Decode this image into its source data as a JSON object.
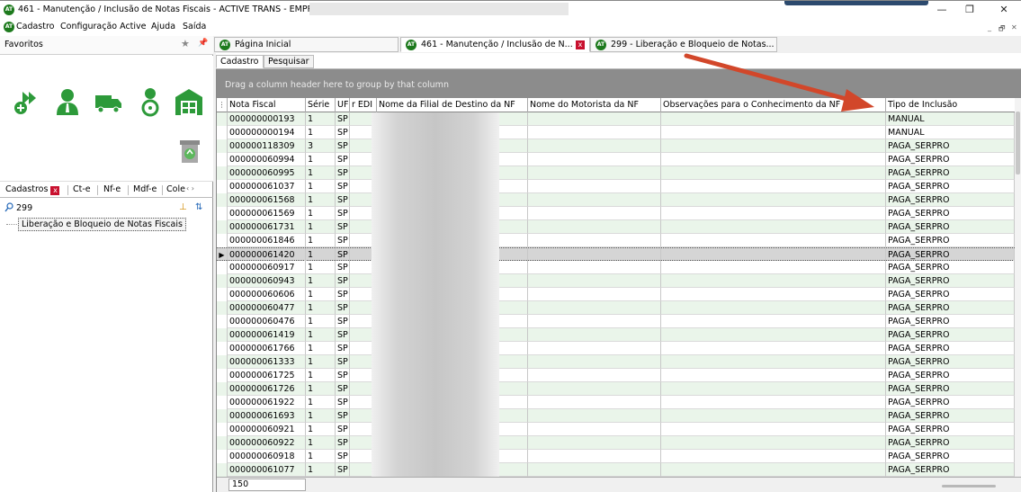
{
  "window": {
    "logo_text": "AT",
    "title": "461 - Manutenção / Inclusão de Notas Fiscais - ACTIVE TRANS - EMPRESA:",
    "minimize": "—",
    "restore": "❐",
    "close": "✕"
  },
  "menu": {
    "items": [
      "Cadastro",
      "Configuração Active",
      "Ajuda",
      "Saída"
    ],
    "mdi_controls": [
      "_",
      "🗗",
      "✕"
    ]
  },
  "favorites": {
    "title": "Favoritos",
    "star": "★",
    "pin": "📌"
  },
  "left_tabs": {
    "items": [
      "Cadastros",
      "Ct-e",
      "Nf-e",
      "Mdf-e",
      "Cole"
    ],
    "close": "x",
    "scroll": "‹  ›"
  },
  "search": {
    "value": "299",
    "tool_a": "⊥",
    "tool_b": "⇅"
  },
  "tree": {
    "item": "Liberação e Bloqueio de Notas Fiscais"
  },
  "doc_tabs": [
    {
      "label": "Página Inicial",
      "closable": false
    },
    {
      "label": "461 - Manutenção / Inclusão de N...",
      "closable": true
    },
    {
      "label": "299 - Liberação e Bloqueio de Notas...",
      "closable": false
    }
  ],
  "sub_tabs": [
    "Cadastro",
    "Pesquisar"
  ],
  "grid": {
    "group_hint": "Drag a column header here to group by that column",
    "indicator": "⋮",
    "headers": [
      "Nota Fiscal",
      "Série",
      "UF",
      "r EDI",
      "Nome da Filial de Destino da NF",
      "Nome do Motorista da NF",
      "Observações para o Conhecimento da NF",
      "Tipo de Inclusão"
    ],
    "rows": [
      {
        "nf": "000000000193",
        "serie": "1",
        "uf": "SP",
        "tipo": "MANUAL"
      },
      {
        "nf": "000000000194",
        "serie": "1",
        "uf": "SP",
        "tipo": "MANUAL"
      },
      {
        "nf": "000000118309",
        "serie": "3",
        "uf": "SP",
        "tipo": "PAGA_SERPRO"
      },
      {
        "nf": "000000060994",
        "serie": "1",
        "uf": "SP",
        "tipo": "PAGA_SERPRO"
      },
      {
        "nf": "000000060995",
        "serie": "1",
        "uf": "SP",
        "tipo": "PAGA_SERPRO"
      },
      {
        "nf": "000000061037",
        "serie": "1",
        "uf": "SP",
        "tipo": "PAGA_SERPRO"
      },
      {
        "nf": "000000061568",
        "serie": "1",
        "uf": "SP",
        "tipo": "PAGA_SERPRO"
      },
      {
        "nf": "000000061569",
        "serie": "1",
        "uf": "SP",
        "tipo": "PAGA_SERPRO"
      },
      {
        "nf": "000000061731",
        "serie": "1",
        "uf": "SP",
        "tipo": "PAGA_SERPRO"
      },
      {
        "nf": "000000061846",
        "serie": "1",
        "uf": "SP",
        "tipo": "PAGA_SERPRO"
      },
      {
        "nf": "000000061420",
        "serie": "1",
        "uf": "SP",
        "tipo": "PAGA_SERPRO",
        "selected": true
      },
      {
        "nf": "000000060917",
        "serie": "1",
        "uf": "SP",
        "tipo": "PAGA_SERPRO"
      },
      {
        "nf": "000000060943",
        "serie": "1",
        "uf": "SP",
        "tipo": "PAGA_SERPRO"
      },
      {
        "nf": "000000060606",
        "serie": "1",
        "uf": "SP",
        "tipo": "PAGA_SERPRO"
      },
      {
        "nf": "000000060477",
        "serie": "1",
        "uf": "SP",
        "tipo": "PAGA_SERPRO"
      },
      {
        "nf": "000000060476",
        "serie": "1",
        "uf": "SP",
        "tipo": "PAGA_SERPRO"
      },
      {
        "nf": "000000061419",
        "serie": "1",
        "uf": "SP",
        "tipo": "PAGA_SERPRO"
      },
      {
        "nf": "000000061766",
        "serie": "1",
        "uf": "SP",
        "tipo": "PAGA_SERPRO"
      },
      {
        "nf": "000000061333",
        "serie": "1",
        "uf": "SP",
        "tipo": "PAGA_SERPRO"
      },
      {
        "nf": "000000061725",
        "serie": "1",
        "uf": "SP",
        "tipo": "PAGA_SERPRO"
      },
      {
        "nf": "000000061726",
        "serie": "1",
        "uf": "SP",
        "tipo": "PAGA_SERPRO"
      },
      {
        "nf": "000000061922",
        "serie": "1",
        "uf": "SP",
        "tipo": "PAGA_SERPRO"
      },
      {
        "nf": "000000061693",
        "serie": "1",
        "uf": "SP",
        "tipo": "PAGA_SERPRO"
      },
      {
        "nf": "000000060921",
        "serie": "1",
        "uf": "SP",
        "tipo": "PAGA_SERPRO"
      },
      {
        "nf": "000000060922",
        "serie": "1",
        "uf": "SP",
        "tipo": "PAGA_SERPRO"
      },
      {
        "nf": "000000060918",
        "serie": "1",
        "uf": "SP",
        "tipo": "PAGA_SERPRO"
      },
      {
        "nf": "000000061077",
        "serie": "1",
        "uf": "SP",
        "tipo": "PAGA_SERPRO"
      }
    ],
    "record_count": "150"
  },
  "colors": {
    "accent_green": "#1d7a1d",
    "row_alt": "#eaf5ea",
    "annotation_arrow": "#d2472a",
    "close_red": "#c8102e"
  }
}
